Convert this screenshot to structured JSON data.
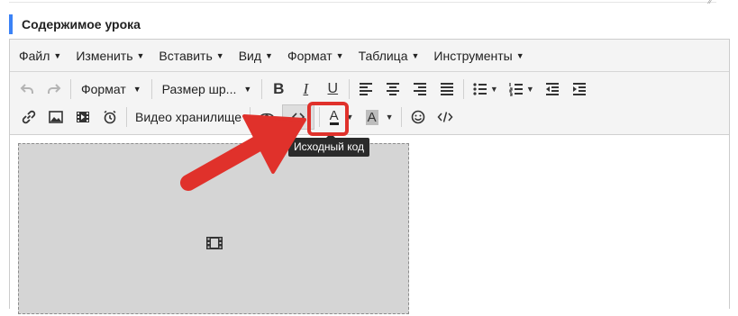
{
  "section": {
    "title": "Содержимое урока"
  },
  "menubar": [
    {
      "label": "Файл"
    },
    {
      "label": "Изменить"
    },
    {
      "label": "Вставить"
    },
    {
      "label": "Вид"
    },
    {
      "label": "Формат"
    },
    {
      "label": "Таблица"
    },
    {
      "label": "Инструменты"
    }
  ],
  "toolbar": {
    "format_select": "Формат",
    "fontsize_select": "Размер шр...",
    "bold": "B",
    "italic": "I",
    "underline": "U",
    "text_color": "A",
    "bg_color": "A",
    "video_storage": "Видео хранилище"
  },
  "tooltip": {
    "text": "Исходный код"
  },
  "colors": {
    "accent": "#3b82f6",
    "highlight": "#e0312b",
    "toolbar_bg": "#f4f4f4",
    "text_color_underline": "#222222",
    "bg_color_swatch": "#bdbdbd"
  },
  "icons": {
    "undo": "undo-icon",
    "redo": "redo-icon",
    "link": "link-icon",
    "image": "image-icon",
    "media": "film-icon",
    "alarm": "alarm-clock-icon",
    "preview": "eye-icon",
    "source_code": "code-brackets-icon",
    "emoticons": "smiley-icon",
    "code_sample": "code-slash-icon"
  }
}
